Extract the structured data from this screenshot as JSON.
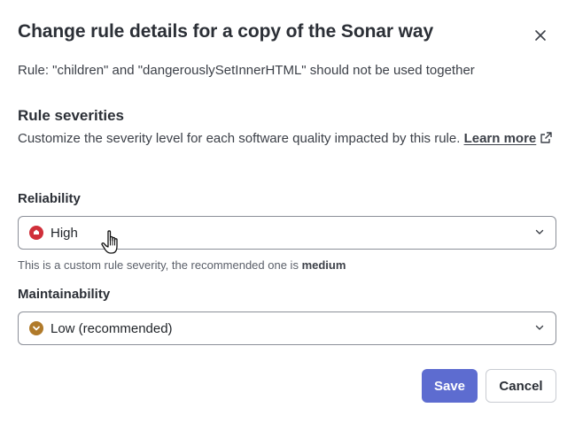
{
  "dialog": {
    "title": "Change rule details for a copy of the Sonar way",
    "rule_text": "Rule: \"children\" and \"dangerouslySetInnerHTML\" should not be used together"
  },
  "severities": {
    "heading": "Rule severities",
    "description": "Customize the severity level for each software quality impacted by this rule. ",
    "learn_more": "Learn more"
  },
  "reliability": {
    "label": "Reliability",
    "value": "High",
    "icon": "severity-high-icon",
    "icon_color": "#d02f3a",
    "helper_prefix": "This is a custom rule severity, the recommended one is ",
    "helper_value": "medium"
  },
  "maintainability": {
    "label": "Maintainability",
    "value": "Low (recommended)",
    "icon": "severity-low-icon",
    "icon_color": "#b07a2a"
  },
  "actions": {
    "save": "Save",
    "cancel": "Cancel",
    "save_color": "#5d6cd0"
  }
}
